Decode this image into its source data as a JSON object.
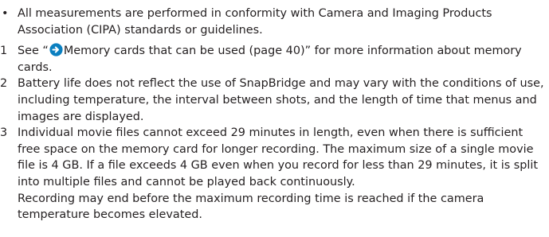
{
  "bullet": {
    "mark": "•",
    "text": "All measurements are performed in conformity with Camera and Imaging Products Association (CIPA) standards or guidelines."
  },
  "notes": [
    {
      "number": "1",
      "prefix": "See “",
      "icon": "arrow-circle-right-icon",
      "link_text": "Memory cards that can be used (page 40)",
      "suffix": "” for more information about memory cards."
    },
    {
      "number": "2",
      "text": "Battery life does not reflect the use of SnapBridge and may vary with the conditions of use, including temperature, the interval between shots, and the length of time that menus and images are displayed."
    },
    {
      "number": "3",
      "text": "Individual movie files cannot exceed 29 minutes in length, even when there is sufficient free space on the memory card for longer recording. The maximum size of a single movie file is 4 GB. If a file exceeds 4 GB even when you record for less than 29 minutes, it is split into multiple files and cannot be played back continuously.",
      "text2": "Recording may end before the maximum recording time is reached if the camera temperature becomes elevated."
    }
  ],
  "colors": {
    "text": "#231f20",
    "icon": "#0a7fc0"
  }
}
